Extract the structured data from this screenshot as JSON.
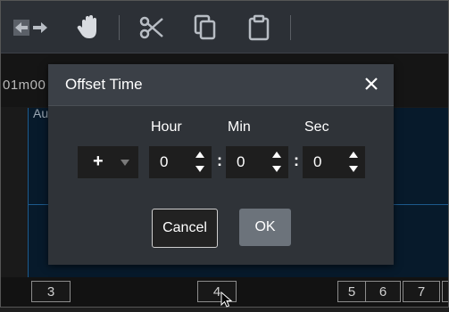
{
  "toolbar": {
    "icons": [
      "arrows-icon",
      "hand-icon",
      "scissors-icon",
      "copy-icon",
      "paste-icon"
    ]
  },
  "timeline": {
    "ruler_text": "01m00",
    "track_label": "Au",
    "segments": [
      "3",
      "4",
      "5",
      "6",
      "7"
    ]
  },
  "dialog": {
    "title": "Offset Time",
    "sign_value": "+",
    "labels": {
      "hour": "Hour",
      "min": "Min",
      "sec": "Sec"
    },
    "values": {
      "hour": "0",
      "min": "0",
      "sec": "0"
    },
    "separator": ":",
    "cancel_label": "Cancel",
    "ok_label": "OK"
  },
  "colors": {
    "dialog_bg": "#2f3338",
    "header_bg": "#3b4047",
    "ok_bg": "#6c737b",
    "track_bg": "#071a2b",
    "track_border": "#1d5a8c"
  }
}
